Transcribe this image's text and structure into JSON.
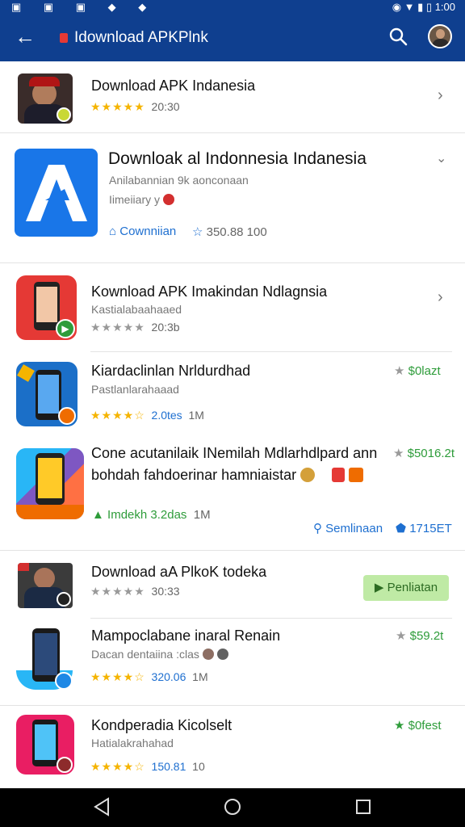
{
  "status": {
    "left_icons": "▣ ▣ ▣ ◆ ◆",
    "time": "1:00"
  },
  "appbar": {
    "title": "Idownload APKPlnk"
  },
  "featured": {
    "name": "Download APK Indanesia",
    "rating": "20:30"
  },
  "card": {
    "name": "Downloak al  Indonnesia Indanesia",
    "line1": "Anilabannian 9k aonconaan",
    "line2": "Iimeiiary y",
    "action1": "Cownniian",
    "action2": "350.88 100"
  },
  "apps": [
    {
      "name": "Kownload APK Imakindan Ndlagnsia",
      "sub": "Kastialabaahaaed",
      "rating": "20:3b"
    },
    {
      "name": "Kiardaclinlan Nrldurdhad",
      "sub": "Pastlanlarahaaad",
      "rating": "2.0tes",
      "count": "1M",
      "price": "$0lazt"
    },
    {
      "name": "Cone acutanilaik INemilah Mdlarhdlpard ann",
      "name2": "bohdah fahdoerinar hamniaistar",
      "price": "$5016.2t",
      "cat": "Imdekh 3.2das",
      "count": "1M",
      "action1": "Semlinaan",
      "action2": "1715ET"
    },
    {
      "name": "Download aA PlkoK todeka",
      "rating": "30:33",
      "button": "Penliatan"
    },
    {
      "name": "Mampoclabane inaral Renain",
      "sub": "Dacan dentaiina :clas",
      "rating": "320.06",
      "count": "1M",
      "price": "$59.2t"
    },
    {
      "name": "Kondperadia Kicolselt",
      "sub": "Hatialakrahahad",
      "rating": "150.81",
      "count": "10",
      "price": "$0fest"
    }
  ]
}
